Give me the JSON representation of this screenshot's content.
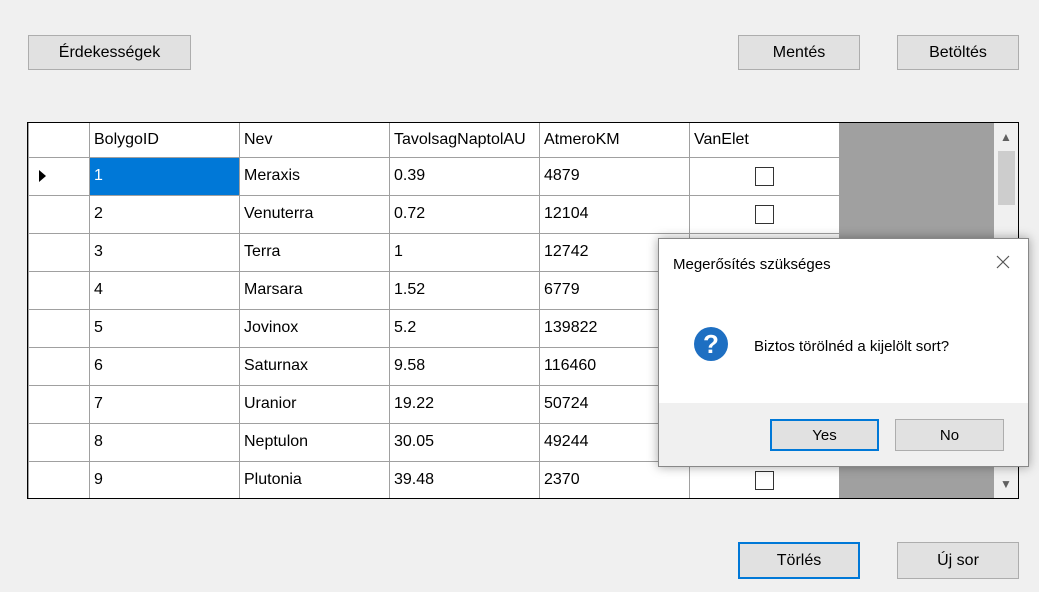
{
  "toolbar": {
    "interests_label": "Érdekességek",
    "save_label": "Mentés",
    "load_label": "Betöltés"
  },
  "grid": {
    "columns": [
      "BolygoID",
      "Nev",
      "TavolsagNaptolAU",
      "AtmeroKM",
      "VanElet"
    ],
    "rows": [
      {
        "id": "1",
        "name": "Meraxis",
        "au": "0.39",
        "km": "4879",
        "life": false
      },
      {
        "id": "2",
        "name": "Venuterra",
        "au": "0.72",
        "km": "12104",
        "life": false
      },
      {
        "id": "3",
        "name": "Terra",
        "au": "1",
        "km": "12742",
        "life": false
      },
      {
        "id": "4",
        "name": "Marsara",
        "au": "1.52",
        "km": "6779",
        "life": false
      },
      {
        "id": "5",
        "name": "Jovinox",
        "au": "5.2",
        "km": "139822",
        "life": false
      },
      {
        "id": "6",
        "name": "Saturnax",
        "au": "9.58",
        "km": "116460",
        "life": false
      },
      {
        "id": "7",
        "name": "Uranior",
        "au": "19.22",
        "km": "50724",
        "life": false
      },
      {
        "id": "8",
        "name": "Neptulon",
        "au": "30.05",
        "km": "49244",
        "life": false
      },
      {
        "id": "9",
        "name": "Plutonia",
        "au": "39.48",
        "km": "2370",
        "life": false
      }
    ],
    "selected_row": 0,
    "current_row_indicator": "row-arrow-icon"
  },
  "dialog": {
    "title": "Megerősítés szükséges",
    "message": "Biztos törölnéd a kijelölt sort?",
    "icon": "question-icon",
    "yes_label": "Yes",
    "no_label": "No"
  },
  "bottom": {
    "delete_label": "Törlés",
    "new_row_label": "Új sor"
  },
  "colors": {
    "selection": "#0078d7",
    "dialog_icon": "#1e6fc2",
    "default_button_border": "#0078d7"
  }
}
